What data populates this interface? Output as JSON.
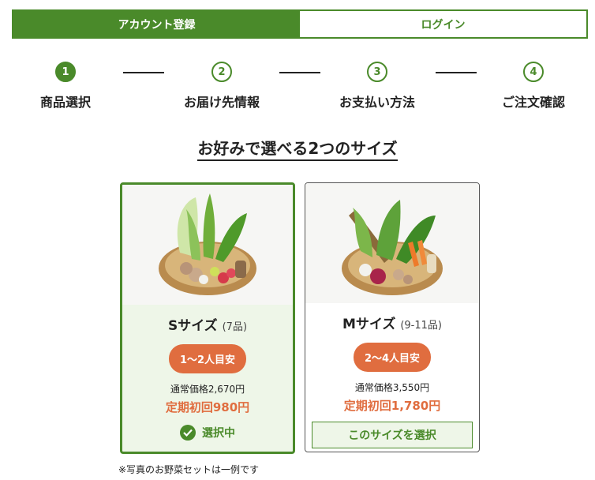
{
  "tabs": {
    "register": "アカウント登録",
    "login": "ログイン"
  },
  "steps": [
    {
      "number": "1",
      "label": "商品選択"
    },
    {
      "number": "2",
      "label": "お届け先情報"
    },
    {
      "number": "3",
      "label": "お支払い方法"
    },
    {
      "number": "4",
      "label": "ご注文確認"
    }
  ],
  "heading": "お好みで選べる2つのサイズ",
  "plans": [
    {
      "name": "Sサイズ",
      "count": "(7品)",
      "people": "1〜2人目安",
      "regular_price": "通常価格2,670円",
      "first_price": "定期初回980円",
      "status_label": "選択中"
    },
    {
      "name": "Mサイズ",
      "count": "(9-11品)",
      "people": "2〜4人目安",
      "regular_price": "通常価格3,550円",
      "first_price": "定期初回1,780円",
      "select_label": "このサイズを選択"
    }
  ],
  "note": "※写真のお野菜セットは一例です",
  "colors": {
    "brand_green": "#4a8a2a",
    "accent_orange": "#e06d3f",
    "selected_bg": "#eef6e8"
  }
}
